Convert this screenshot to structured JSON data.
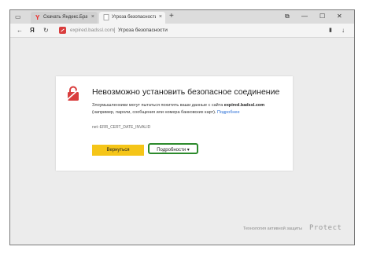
{
  "tabbar": {
    "tabs": [
      {
        "title": "Скачать Яндекс.Браузер д",
        "close": "×",
        "active": false
      },
      {
        "title": "Угроза безопасности",
        "close": "×",
        "active": true
      }
    ],
    "new_tab": "+",
    "window_controls": {
      "minimize": "—",
      "maximize": "☐",
      "close": "✕"
    }
  },
  "navbar": {
    "back": "←",
    "yandex": "Я",
    "reload": "↻",
    "url": "expired.badssl.com",
    "page_title": "Угроза безопасности",
    "bookmark": "🔖",
    "menu": "↓"
  },
  "card": {
    "heading": "Невозможно установить безопасное соединение",
    "desc_prefix": "Злоумышленники могут пытаться похитить ваши данные с сайта ",
    "desc_domain": "expired.badssl.com",
    "desc_suffix": " (например, пароли, сообщения или номера банковских карт).",
    "desc_link": "Подробнее",
    "error_code": "net::ERR_CERT_DATE_INVALID",
    "back_button": "Вернуться",
    "details_button": "Подробности ▾"
  },
  "footer": {
    "protect_text": "Технология активной защиты",
    "protect_logo": "Protect"
  },
  "colors": {
    "accent_yellow": "#f5c518",
    "danger_red": "#d93d3d",
    "highlight_green": "#2c8a2c",
    "link_blue": "#2b6fd6"
  }
}
